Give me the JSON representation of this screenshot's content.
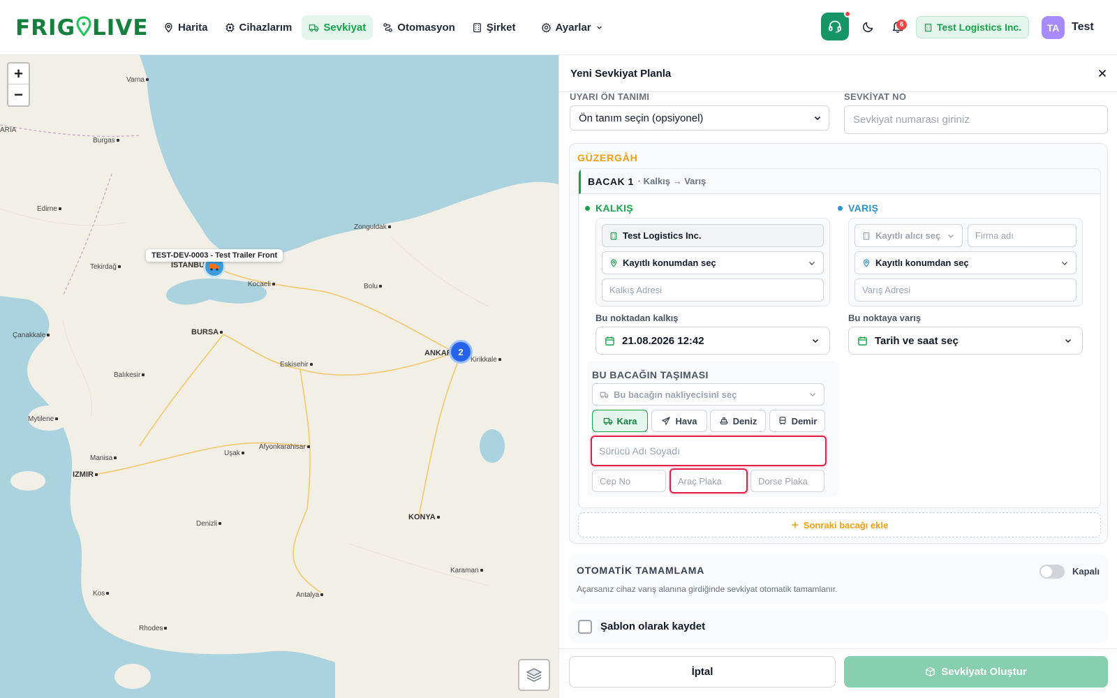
{
  "brand": {
    "name_left": "FRIG",
    "name_mid": "LIV",
    "name_right": "E",
    "color": "#15803d"
  },
  "nav": {
    "items": [
      {
        "label": "Harita",
        "icon": "map-pin-icon",
        "active": false
      },
      {
        "label": "Cihazlarım",
        "icon": "chip-icon",
        "active": false
      },
      {
        "label": "Sevkiyat",
        "icon": "truck-icon",
        "active": true
      },
      {
        "label": "Otomasyon",
        "icon": "route-icon",
        "active": false
      },
      {
        "label": "Şirket",
        "icon": "building-icon",
        "active": false
      },
      {
        "label": "Ayarlar",
        "icon": "gear-icon",
        "active": false,
        "has_dropdown": true
      }
    ]
  },
  "header": {
    "notifications_count": "6",
    "company": "Test Logistics Inc.",
    "avatar_initials": "TA",
    "user_name": "Test"
  },
  "map": {
    "zoom_in": "+",
    "zoom_out": "−",
    "cities": [
      "Varna",
      "Burgas",
      "Edirne",
      "Tekirdağ",
      "ISTANBUL",
      "Kocaeli",
      "Zonguldak",
      "Bolu",
      "Çanakkale",
      "BURSA",
      "Eskisehir",
      "ANKARA",
      "Kirikkale",
      "Balıkesir",
      "Mytilene",
      "Manisa",
      "IZMIR",
      "Uşak",
      "Afyonkarahisar",
      "Denizli",
      "KONYA",
      "Karaman",
      "Kos",
      "Antalya",
      "Rhodes",
      "ARIA"
    ],
    "device_tooltip": "TEST-DEV-0003 - Test Trailer Front",
    "cluster_count": "2"
  },
  "panel": {
    "title": "Yeni Sevkiyat Planla",
    "warning_preset": {
      "label": "UYARI ÖN TANIMI",
      "value": "Ön tanım seçin (opsiyonel)"
    },
    "shipment_no": {
      "label": "SEVKİYAT NO",
      "placeholder": "Sevkiyat numarası giriniz",
      "value": ""
    },
    "route": {
      "title": "GÜZERGÂH",
      "leg": {
        "title": "BACAK 1",
        "subtitle": "· Kalkış → Varış",
        "departure": {
          "title": "KALKIŞ",
          "color": "#16a34a",
          "company": "Test Logistics Inc.",
          "location_select": "Kayıtlı konumdan seç",
          "address_placeholder": "Kalkış Adresi",
          "time_label": "Bu noktadan kalkış",
          "time_value": "21.08.2026 12:42"
        },
        "arrival": {
          "title": "VARIŞ",
          "color": "#2f90d2",
          "receiver_select": "Kayıtlı alıcı seç",
          "company_placeholder": "Firma adı",
          "location_select": "Kayıtlı konumdan seç",
          "address_placeholder": "Varış Adresi",
          "time_label": "Bu noktaya varış",
          "time_value": "Tarih ve saat seç"
        },
        "transport": {
          "title": "BU BACAĞIN TAŞIMASI",
          "carrier_select": "Bu bacağın nakliyecisini seç",
          "modes": [
            {
              "label": "Kara",
              "icon": "truck-icon",
              "active": true
            },
            {
              "label": "Hava",
              "icon": "plane-icon",
              "active": false
            },
            {
              "label": "Deniz",
              "icon": "ship-icon",
              "active": false
            },
            {
              "label": "Demir",
              "icon": "train-icon",
              "active": false
            }
          ],
          "driver_placeholder": "Sürücü Adı Soyadı",
          "phone_placeholder": "Cep No",
          "vehicle_plate_placeholder": "Araç Plaka",
          "trailer_plate_placeholder": "Dorse Plaka"
        }
      },
      "add_leg": "Sonraki bacağı ekle"
    },
    "auto_complete": {
      "title": "OTOMATİK TAMAMLAMA",
      "description": "Açarsanız cihaz varış alanına girdiğinde sevkiyat otomatik tamamlanır.",
      "toggle_label": "Kapalı",
      "enabled": false
    },
    "save_template": {
      "label": "Şablon olarak kaydet",
      "checked": false
    },
    "footer": {
      "cancel": "İptal",
      "create": "Sevkiyatı Oluştur"
    }
  }
}
